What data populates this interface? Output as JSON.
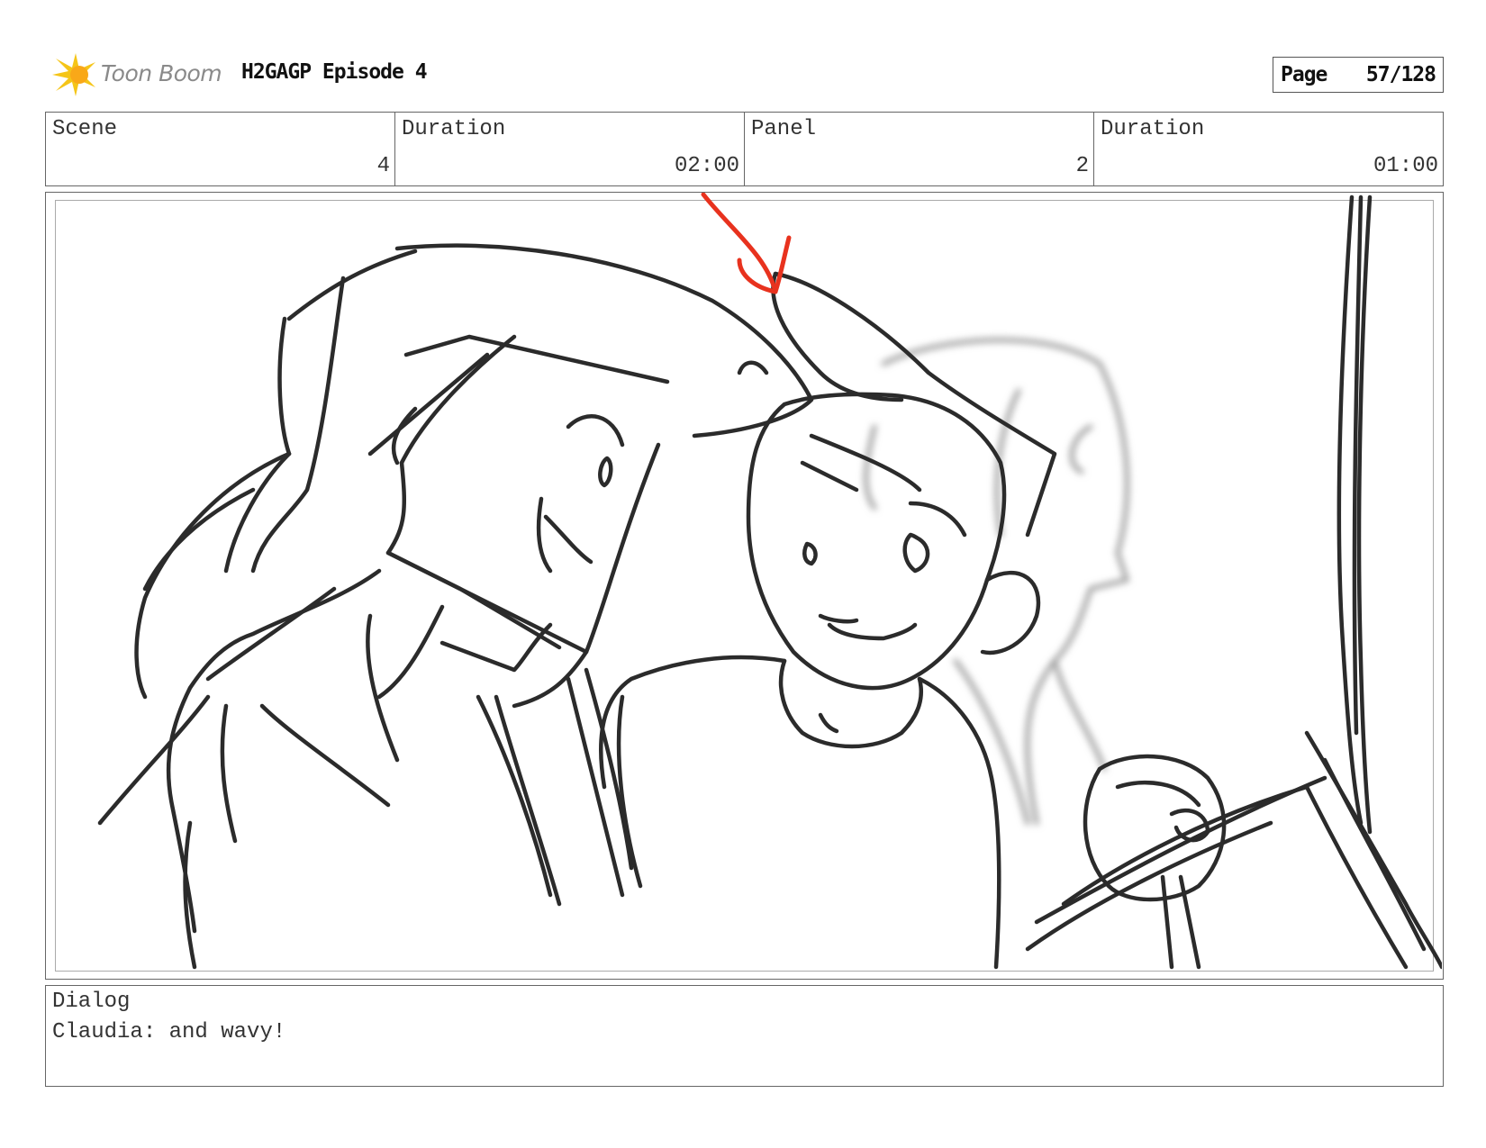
{
  "header": {
    "brand": "Toon Boom",
    "episode_title": "H2GAGP Episode 4",
    "page_label": "Page",
    "page_number": "57/128"
  },
  "info": {
    "scene_label": "Scene",
    "scene_value": "4",
    "scene_duration_label": "Duration",
    "scene_duration_value": "02:00",
    "panel_label": "Panel",
    "panel_value": "2",
    "panel_duration_label": "Duration",
    "panel_duration_value": "01:00"
  },
  "dialog": {
    "label": "Dialog",
    "text": "Claudia: and wavy!"
  },
  "colors": {
    "logo_yellow": "#f5c518",
    "annotation_red": "#e8321e",
    "line": "#2b2b2b"
  }
}
